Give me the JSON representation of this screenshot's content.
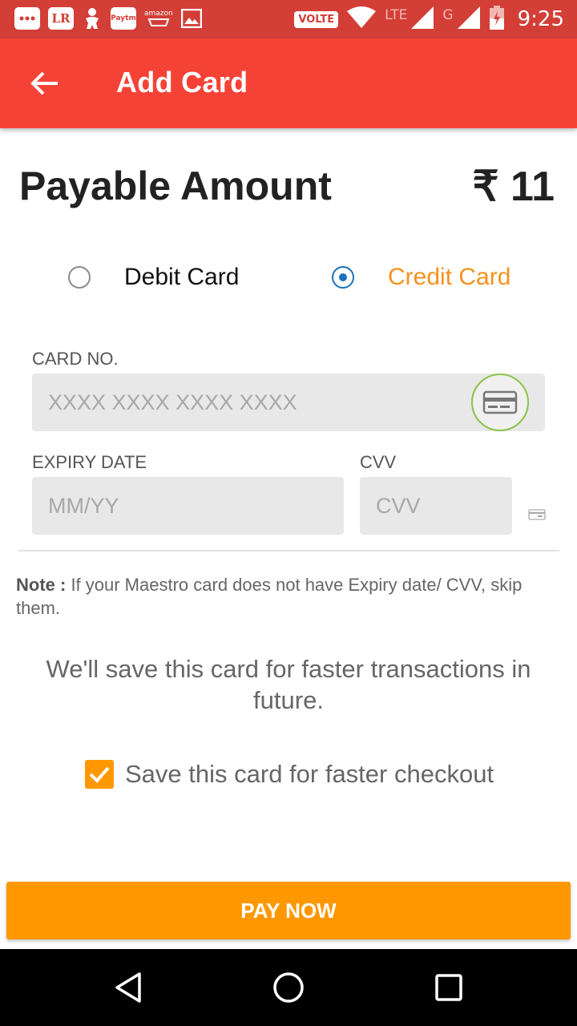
{
  "status_bar": {
    "time": "9:25",
    "volte_label": "VOLTE",
    "lte_label": "LTE",
    "g_label": "G",
    "notification_icons": [
      "chat-bubble-icon",
      "lr-app-icon",
      "baby-icon",
      "paytm-icon",
      "amazon-icon",
      "gallery-icon"
    ],
    "lr_text": "LR",
    "paytm_text": "Paytm",
    "amazon_text": "amazon"
  },
  "app_bar": {
    "title": "Add Card",
    "back_icon": "arrow-left-icon",
    "color": "#f44336"
  },
  "payment": {
    "label": "Payable Amount",
    "amount": "₹ 11"
  },
  "card_type": {
    "options": [
      {
        "label": "Debit Card",
        "selected": false
      },
      {
        "label": "Credit Card",
        "selected": true
      }
    ],
    "active_color": "#f5921e"
  },
  "form": {
    "card_no_label": "CARD NO.",
    "card_no_placeholder": "XXXX XXXX XXXX XXXX",
    "expiry_label": "EXPIRY DATE",
    "expiry_placeholder": "MM/YY",
    "cvv_label": "CVV",
    "cvv_placeholder": "CVV"
  },
  "note": {
    "prefix": "Note :",
    "text": " If your Maestro card does not have Expiry date/ CVV, skip them."
  },
  "save_message": "We'll save this card for faster transactions in future.",
  "save_checkbox": {
    "label": "Save this card for faster checkout",
    "checked": true
  },
  "pay_button": {
    "label": "PAY NOW",
    "color": "#ff9800"
  },
  "nav_bar": {
    "buttons": [
      "back-triangle-icon",
      "home-circle-icon",
      "recents-square-icon"
    ]
  }
}
